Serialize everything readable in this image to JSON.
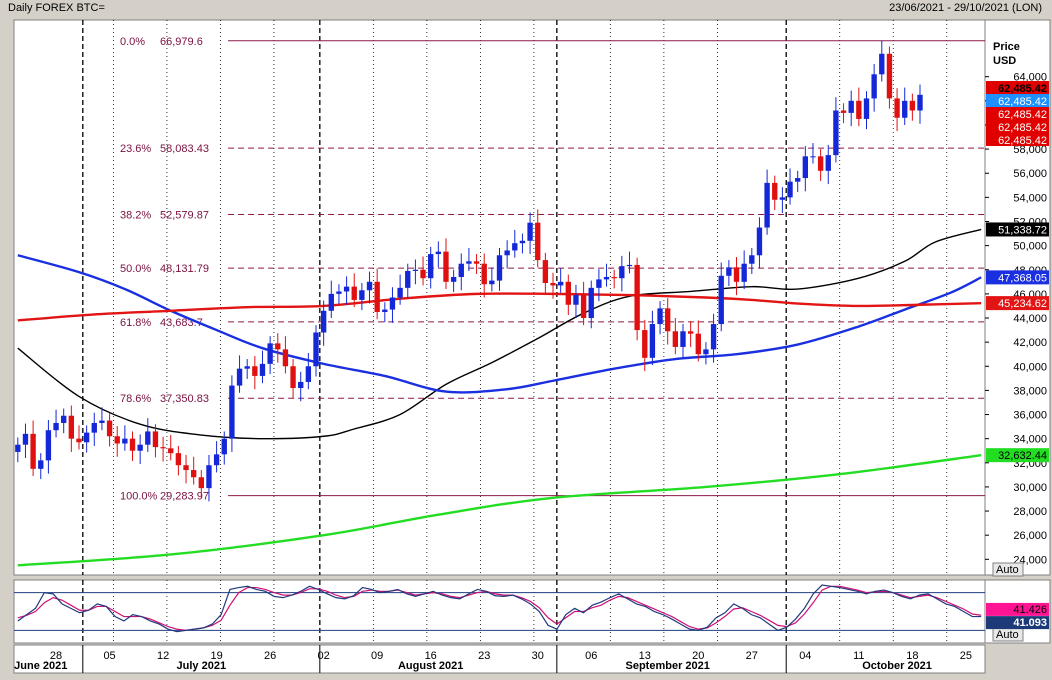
{
  "header": {
    "title": "Daily FOREX BTC=",
    "date_range": "23/06/2021 - 29/10/2021 (LON)"
  },
  "axis": {
    "price_label_1": "Price",
    "price_label_2": "USD",
    "auto_main": "Auto",
    "auto_osc": "Auto"
  },
  "chart_data": {
    "type": "candlestick",
    "ylim": [
      22700,
      68700
    ],
    "y_ticks": [
      24000,
      26000,
      28000,
      30000,
      32000,
      34000,
      36000,
      38000,
      40000,
      42000,
      44000,
      46000,
      48000,
      50000,
      52000,
      54000,
      56000,
      58000,
      60000,
      62000,
      64000
    ],
    "y_tick_labels": [
      "24,000",
      "26,000",
      "28,000",
      "30,000",
      "32,000",
      "34,000",
      "36,000",
      "38,000",
      "40,000",
      "42,000",
      "44,000",
      "46,000",
      "48,000",
      "50,000",
      "52,000",
      "54,000",
      "56,000",
      "58,000",
      "60,000",
      "62,000",
      "64,000"
    ],
    "x_day_labels": [
      "28",
      "05",
      "12",
      "19",
      "26",
      "02",
      "09",
      "16",
      "23",
      "30",
      "06",
      "13",
      "20",
      "27",
      "04",
      "11",
      "18",
      "25"
    ],
    "x_day_index": [
      5,
      12,
      19,
      26,
      33,
      40,
      47,
      54,
      61,
      68,
      75,
      82,
      89,
      96,
      103,
      110,
      117,
      124
    ],
    "month_labels": [
      {
        "label": "June 2021",
        "index": 3
      },
      {
        "label": "July 2021",
        "index": 24
      },
      {
        "label": "August 2021",
        "index": 54
      },
      {
        "label": "September 2021",
        "index": 85
      },
      {
        "label": "October 2021",
        "index": 115
      }
    ],
    "month_separators": [
      8.5,
      39.5,
      70.5,
      100.5
    ],
    "week_separators": [
      12.5,
      19.5,
      26.5,
      33.5,
      46.5,
      53.5,
      60.5,
      67.5,
      77.5,
      84.5,
      91.5,
      107.5,
      114.5,
      121.5
    ],
    "fibonacci": [
      {
        "label": "0.0%",
        "value": 66979.6,
        "text": "66,979.6"
      },
      {
        "label": "23.6%",
        "value": 58083.43,
        "text": "58,083.43"
      },
      {
        "label": "38.2%",
        "value": 52579.87,
        "text": "52,579.87"
      },
      {
        "label": "50.0%",
        "value": 48131.79,
        "text": "48,131.79"
      },
      {
        "label": "61.8%",
        "value": 43683.7,
        "text": "43,683.7"
      },
      {
        "label": "78.6%",
        "value": 37350.83,
        "text": "37,350.83"
      },
      {
        "label": "100.0%",
        "value": 29283.97,
        "text": "29,283.97"
      }
    ],
    "fib_start_index": 28,
    "closes": [
      33500,
      34400,
      31500,
      32200,
      34700,
      35300,
      35900,
      34000,
      33700,
      34500,
      35300,
      35500,
      34200,
      33600,
      34000,
      33000,
      33500,
      34600,
      33300,
      33200,
      32800,
      31800,
      31400,
      30800,
      29900,
      31800,
      32700,
      34000,
      38400,
      39800,
      40000,
      39200,
      40200,
      41900,
      41400,
      40000,
      38200,
      38700,
      40000,
      42800,
      44600,
      46000,
      46200,
      46600,
      45500,
      46300,
      47000,
      44500,
      44700,
      45700,
      46500,
      47900,
      48000,
      47300,
      49300,
      49500,
      47000,
      47400,
      48500,
      48700,
      48500,
      46800,
      47100,
      49200,
      49600,
      50200,
      50400,
      51900,
      48800,
      46900,
      46700,
      47000,
      45100,
      45900,
      44000,
      46500,
      47200,
      47400,
      47300,
      48300,
      48400,
      43000,
      40700,
      43500,
      44800,
      42900,
      41600,
      42900,
      42700,
      41000,
      41400,
      43500,
      47500,
      48200,
      47000,
      48500,
      49200,
      51500,
      55200,
      53800,
      54000,
      55300,
      55600,
      57400,
      57400,
      56200,
      57500,
      61200,
      61000,
      62000,
      60500,
      62200,
      64200,
      65900,
      62200,
      60600,
      62000,
      61200,
      62500
    ],
    "series": [
      {
        "name": "200-day MA",
        "value": 32632.44,
        "color": "#22dd22",
        "label": "32,632.44",
        "points": [
          [
            0,
            23500
          ],
          [
            20,
            24400
          ],
          [
            40,
            26000
          ],
          [
            55,
            27700
          ],
          [
            70,
            29100
          ],
          [
            90,
            30000
          ],
          [
            108,
            31100
          ],
          [
            126,
            32630
          ]
        ]
      },
      {
        "name": "50-day MA",
        "value": 51338.72,
        "color": "#000000",
        "label": "51,338.72",
        "points": [
          [
            0,
            41500
          ],
          [
            8,
            37500
          ],
          [
            16,
            35200
          ],
          [
            24,
            34300
          ],
          [
            32,
            34000
          ],
          [
            40,
            34200
          ],
          [
            44,
            34800
          ],
          [
            50,
            36000
          ],
          [
            56,
            38500
          ],
          [
            62,
            40300
          ],
          [
            68,
            42300
          ],
          [
            74,
            44400
          ],
          [
            80,
            45800
          ],
          [
            88,
            46200
          ],
          [
            96,
            46600
          ],
          [
            102,
            46400
          ],
          [
            110,
            47300
          ],
          [
            116,
            48700
          ],
          [
            120,
            50300
          ],
          [
            126,
            51340
          ]
        ]
      },
      {
        "name": "100-day MA",
        "value": 47368.05,
        "color": "#1a2fe0",
        "label": "47,368.05",
        "points": [
          [
            0,
            49200
          ],
          [
            8,
            47800
          ],
          [
            14,
            46400
          ],
          [
            20,
            44600
          ],
          [
            26,
            43000
          ],
          [
            32,
            41500
          ],
          [
            40,
            40200
          ],
          [
            48,
            39200
          ],
          [
            56,
            37900
          ],
          [
            64,
            38100
          ],
          [
            70,
            38800
          ],
          [
            78,
            39800
          ],
          [
            86,
            40600
          ],
          [
            94,
            41000
          ],
          [
            102,
            41800
          ],
          [
            110,
            43300
          ],
          [
            116,
            44700
          ],
          [
            122,
            46100
          ],
          [
            126,
            47370
          ]
        ]
      },
      {
        "name": "40-day MA",
        "value": 45234.62,
        "color": "#e21414",
        "label": "45,234.62",
        "points": [
          [
            0,
            43800
          ],
          [
            10,
            44300
          ],
          [
            20,
            44600
          ],
          [
            30,
            44900
          ],
          [
            40,
            45000
          ],
          [
            50,
            45600
          ],
          [
            60,
            46000
          ],
          [
            70,
            46000
          ],
          [
            80,
            45900
          ],
          [
            90,
            45700
          ],
          [
            96,
            45500
          ],
          [
            102,
            45200
          ],
          [
            110,
            45000
          ],
          [
            118,
            45100
          ],
          [
            126,
            45230
          ]
        ]
      }
    ],
    "price_tags": [
      {
        "label": "62,485.42",
        "bg": "#e00000",
        "fg": "#000000",
        "y_slot": 0
      },
      {
        "label": "62,485.42",
        "bg": "#1e90ff",
        "fg": "#ffffff",
        "y_slot": 1
      },
      {
        "label": "62,485.42",
        "bg": "#e00000",
        "fg": "#ffffff",
        "y_slot": 2
      },
      {
        "label": "62,485.42",
        "bg": "#e00000",
        "fg": "#ffffff",
        "y_slot": 3
      },
      {
        "label": "62,485.42",
        "bg": "#e00000",
        "fg": "#ffffff",
        "y_slot": 4
      }
    ],
    "oscillator": {
      "k": [
        35,
        45,
        55,
        80,
        78,
        62,
        55,
        48,
        52,
        62,
        58,
        42,
        35,
        45,
        42,
        35,
        30,
        22,
        18,
        20,
        22,
        24,
        30,
        45,
        85,
        88,
        90,
        85,
        82,
        74,
        72,
        76,
        82,
        90,
        85,
        78,
        72,
        70,
        75,
        88,
        85,
        80,
        82,
        85,
        78,
        74,
        78,
        82,
        76,
        72,
        70,
        78,
        85,
        82,
        75,
        74,
        76,
        70,
        62,
        50,
        28,
        22,
        45,
        55,
        48,
        60,
        65,
        72,
        78,
        70,
        62,
        58,
        50,
        45,
        38,
        30,
        22,
        20,
        25,
        40,
        48,
        62,
        55,
        45,
        40,
        30,
        20,
        25,
        38,
        55,
        78,
        92,
        90,
        88,
        85,
        82,
        78,
        82,
        84,
        80,
        74,
        70,
        76,
        78,
        70,
        62,
        58,
        50,
        42,
        42
      ],
      "d": [
        40,
        44,
        50,
        64,
        72,
        68,
        60,
        52,
        52,
        58,
        58,
        50,
        42,
        42,
        42,
        38,
        32,
        26,
        22,
        20,
        22,
        24,
        28,
        36,
        60,
        80,
        88,
        88,
        85,
        80,
        76,
        76,
        80,
        86,
        86,
        82,
        76,
        72,
        74,
        82,
        84,
        82,
        82,
        84,
        80,
        76,
        78,
        80,
        78,
        74,
        72,
        76,
        80,
        82,
        78,
        76,
        76,
        72,
        66,
        56,
        40,
        30,
        40,
        50,
        50,
        56,
        60,
        68,
        74,
        72,
        66,
        60,
        54,
        48,
        42,
        34,
        26,
        22,
        24,
        32,
        42,
        54,
        56,
        50,
        44,
        36,
        28,
        26,
        32,
        46,
        64,
        84,
        90,
        90,
        87,
        84,
        80,
        81,
        82,
        80,
        76,
        72,
        74,
        76,
        72,
        66,
        60,
        54,
        46,
        44
      ],
      "k_label": "41.426",
      "d_label": "41.093"
    }
  }
}
